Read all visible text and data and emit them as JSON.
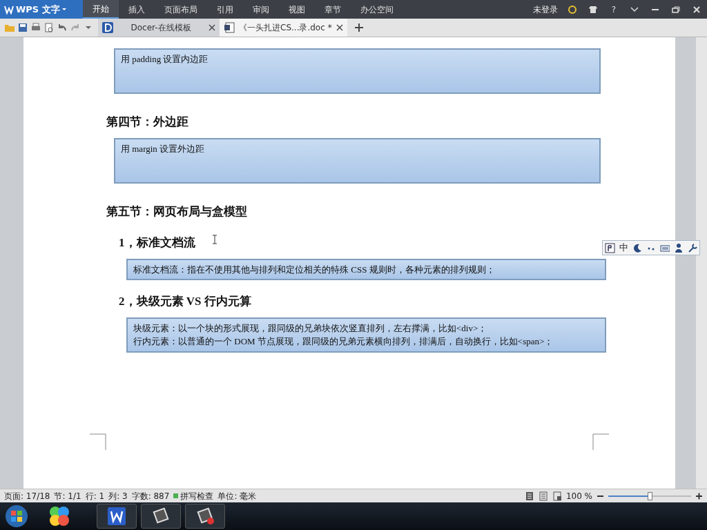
{
  "app_menu": {
    "label": "WPS 文字"
  },
  "menu_tabs": [
    {
      "label": "开始",
      "selected": true
    },
    {
      "label": "插入",
      "selected": false
    },
    {
      "label": "页面布局",
      "selected": false
    },
    {
      "label": "引用",
      "selected": false
    },
    {
      "label": "审阅",
      "selected": false
    },
    {
      "label": "视图",
      "selected": false
    },
    {
      "label": "章节",
      "selected": false
    },
    {
      "label": "办公空间",
      "selected": false
    }
  ],
  "login": "未登录",
  "help": "?",
  "doc_tabs": [
    {
      "label": "Docer-在线模板",
      "selected": false,
      "kind": "docer"
    },
    {
      "label": "《一头扎进CS...录.doc *",
      "selected": true,
      "kind": "doc"
    }
  ],
  "document": {
    "blocks": [
      {
        "kind": "box",
        "lines": [
          "用 padding 设置内边距"
        ]
      },
      {
        "kind": "heading",
        "text": "第四节：外边距"
      },
      {
        "kind": "box",
        "lines": [
          "用 margin 设置外边距"
        ]
      },
      {
        "kind": "heading",
        "text": "第五节：网页布局与盒模型"
      },
      {
        "kind": "subheading",
        "text": "1，标准文档流"
      },
      {
        "kind": "box",
        "lines": [
          "标准文档流：指在不使用其他与排列和定位相关的特殊 CSS 规则时，各种元素的排列规则；"
        ]
      },
      {
        "kind": "subheading",
        "text": "2，块级元素 VS 行内元算"
      },
      {
        "kind": "box",
        "lines": [
          "块级元素：以一个块的形式展现，跟同级的兄弟块依次竖直排列，左右撑满，比如<div>；",
          "行内元素：以普通的一个 DOM 节点展现，跟同级的兄弟元素横向排列，排满后，自动换行，比如<span>；"
        ]
      }
    ]
  },
  "ime_toolbar": {
    "label": "中"
  },
  "status_bar": {
    "items": [
      "页面: 17/18",
      "节: 1/1",
      "行: 1",
      "列: 3",
      "字数: 887"
    ],
    "spell_check": "拼写检查",
    "unit": "单位: 毫米"
  },
  "zoom": {
    "label": "100 %",
    "level": 0.5
  }
}
